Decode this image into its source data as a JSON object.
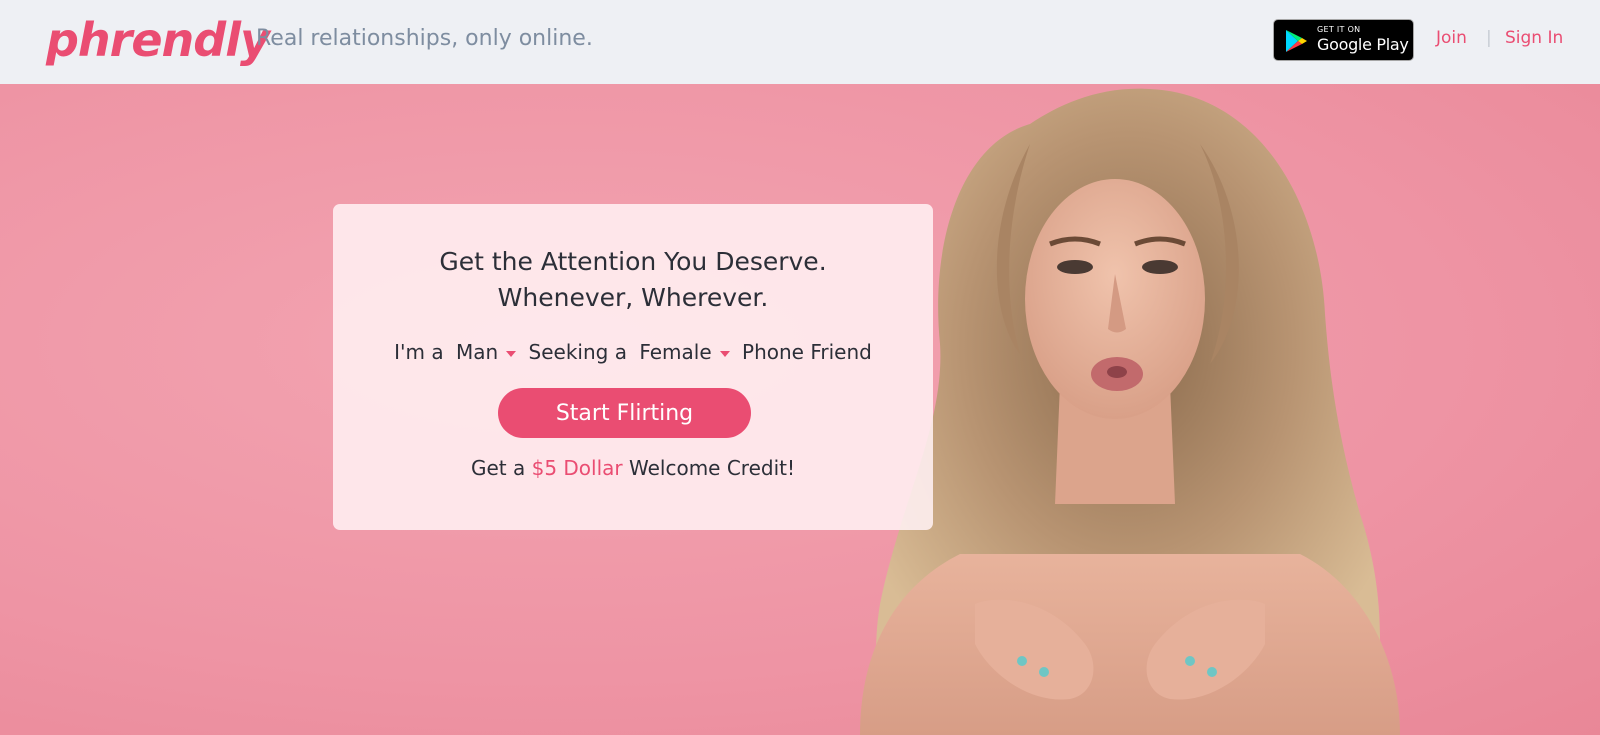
{
  "header": {
    "logo_text": "phrendly",
    "tagline": "Real relationships, only online.",
    "google_play": {
      "small_text": "GET IT ON",
      "big_text": "Google Play"
    },
    "join_label": "Join",
    "separator": "|",
    "signin_label": "Sign In"
  },
  "hero": {
    "headline_line1": "Get the Attention You Deserve.",
    "headline_line2": "Whenever, Wherever.",
    "im_a": "I'm a",
    "gender_value": "Man",
    "seeking_a": "Seeking a",
    "seeking_value": "Female",
    "phone_friend": "Phone Friend",
    "cta_label": "Start Flirting",
    "credit_prefix": "Get a",
    "credit_amount": "$5 Dollar",
    "credit_suffix": "Welcome Credit!"
  },
  "colors": {
    "brand": "#ea4d72",
    "header_bg": "#eef0f4",
    "hero_bg": "#ee94a4",
    "text_dark": "#2c2f38",
    "tagline_gray": "#7e8da0"
  }
}
